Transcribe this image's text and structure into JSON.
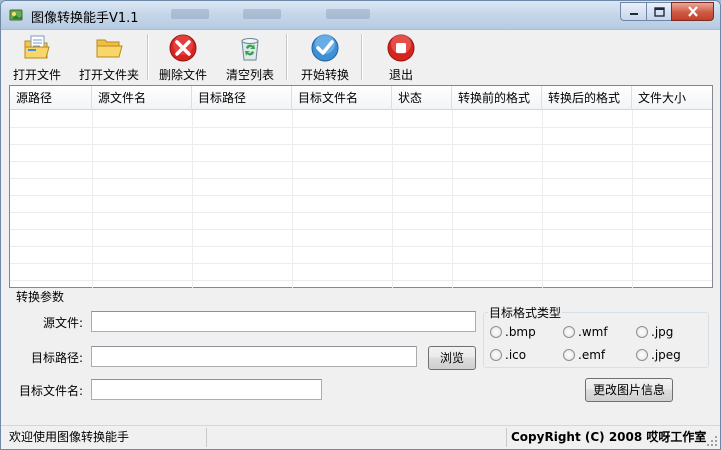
{
  "window": {
    "title": "图像转换能手V1.1",
    "controls": [
      "minimize",
      "maximize",
      "close"
    ]
  },
  "toolbar": {
    "buttons": [
      {
        "label": "打开文件",
        "icon": "open-file-icon"
      },
      {
        "label": "打开文件夹",
        "icon": "open-folder-icon"
      },
      {
        "label": "删除文件",
        "icon": "delete-icon"
      },
      {
        "label": "清空列表",
        "icon": "recycle-bin-icon"
      },
      {
        "label": "开始转换",
        "icon": "checkmark-icon"
      },
      {
        "label": "退出",
        "icon": "stop-icon"
      }
    ]
  },
  "file_list": {
    "columns": [
      "源路径",
      "源文件名",
      "目标路径",
      "目标文件名",
      "状态",
      "转换前的格式",
      "转换后的格式",
      "文件大小"
    ],
    "rows": []
  },
  "params": {
    "group_title": "转换参数",
    "source_file_label": "源文件:",
    "source_file_value": "",
    "target_path_label": "目标路径:",
    "target_path_value": "",
    "browse_label": "浏览",
    "target_filename_label": "目标文件名:",
    "target_filename_value": "",
    "format_group_title": "目标格式类型",
    "formats": [
      ".bmp",
      ".wmf",
      ".jpg",
      ".ico",
      ".emf",
      ".jpeg"
    ],
    "modify_button_label": "更改图片信息"
  },
  "statusbar": {
    "message": "欢迎使用图像转换能手",
    "copyright": "CopyRight (C) 2008 哎呀工作室"
  },
  "colors": {
    "titlebar": "#c6d7ea",
    "close_button": "#cf5a44",
    "window_bg": "#f0f0f0"
  }
}
